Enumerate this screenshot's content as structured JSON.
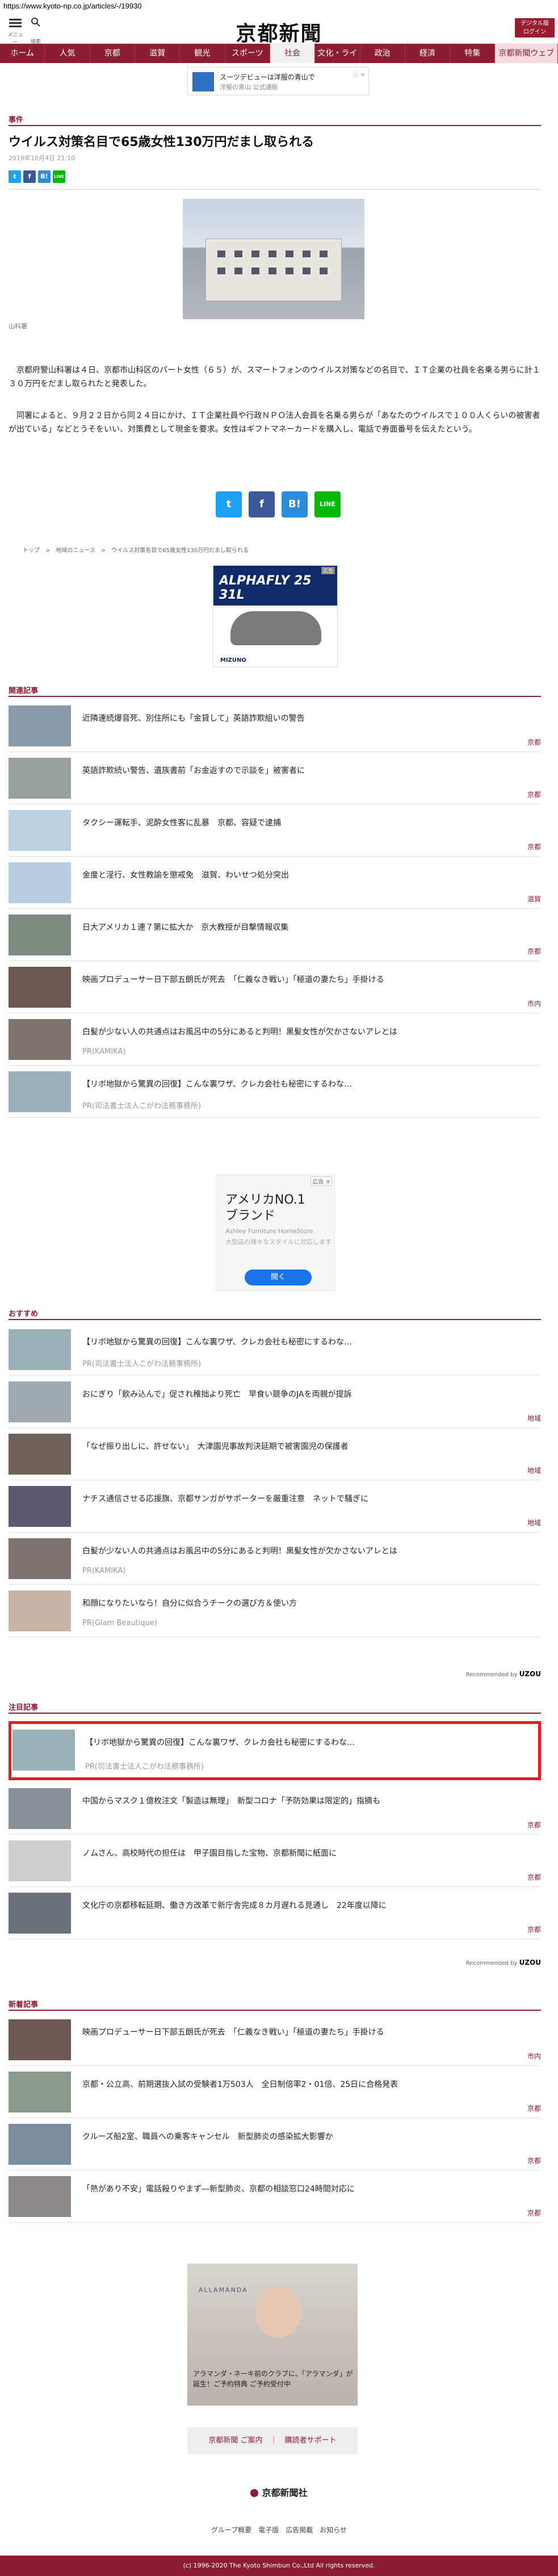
{
  "url": "https://www.kyoto-np.co.jp/articles/-/19930",
  "header": {
    "menu_label": "メニュー",
    "search_label": "検索",
    "logo": "京都新聞",
    "digital_label_1": "デジタル版",
    "digital_label_2": "ログイン"
  },
  "nav": [
    "ホーム",
    "人気",
    "京都",
    "滋賀",
    "観光",
    "スポーツ",
    "社会",
    "文化・ライフ",
    "政治",
    "経済",
    "特集",
    "京都新聞ウェブ"
  ],
  "top_ad": {
    "line1": "スーツデビューは洋服の青山で",
    "line2": "洋服の青山 公式通販",
    "close": "ⓘ ✕"
  },
  "article": {
    "section": "事件",
    "headline": "ウイルス対策名目で65歳女性130万円だまし取られる",
    "date": "2019年10月4日 21:10",
    "caption": "山科署",
    "p1": "京都府警山科署は４日、京都市山科区のパート女性（６５）が、スマートフォンのウイルス対策などの名目で、ＩＴ企業の社員を名乗る男らに計１３０万円をだまし取られたと発表した。",
    "p2": "同署によると、９月２２日から同２４日にかけ、ＩＴ企業社員や行政ＮＰＯ法人会員を名乗る男らが「あなたのウイルスで１００人くらいの被害者が出ている」などとうそをいい、対策費として現金を要求。女性はギフトマネーカードを購入し、電話で券面番号を伝えたという。"
  },
  "share": {
    "t": "t",
    "f": "f",
    "b": "B!",
    "line": "LINE"
  },
  "breadcrumb": "トップ　>　地域のニュース　>　ウイルス対策名目で65歳女性130万円だまし取られる",
  "mid_ad": {
    "brand": "ALPHAFLY 25 31L",
    "maker": "MIZUNO",
    "tag": "広告"
  },
  "related": {
    "title": "関連記事",
    "items": [
      {
        "title": "近隣連続爆音死、別住所にも「金貸して」英語詐欺組いの警告",
        "src": "京都"
      },
      {
        "title": "英語詐欺続い警告、遺族書前「お金返すので示談を」被害者に",
        "src": "京都"
      },
      {
        "title": "タクシー運転手、泥酔女性客に乱暴　京都、容疑で逮捕",
        "src": "京都"
      },
      {
        "title": "金度と淫行、女性教諭を懲戒免　滋賀、わいせつ処分突出",
        "src": "滋賀"
      },
      {
        "title": "日大アメリカ１連７第に拡大か　京大教授が目撃情報収集",
        "src": "京都"
      },
      {
        "title": "映画プロデューサー日下部五朗氏が死去　「仁義なき戦い」「極道の妻たち」手掛ける",
        "src": "市内"
      },
      {
        "title": "白髪が少ない人の共通点はお風呂中の5分にあると判明！黒髪女性が欠かさないアレとは",
        "pr": "PR(KAMIKA)"
      },
      {
        "title": "【リボ地獄から驚異の回復】こんな裏ワザ、クレカ会社も秘密にするわな…",
        "pr": "PR(司法書士法人こがわ法務事務所)"
      }
    ]
  },
  "ad2": {
    "tag": "広告 ✕",
    "line1": "アメリカNO.1",
    "line2": "ブランド",
    "advertiser": "Ashley Furniture HomeStore",
    "desc": "大型店の様々なスタイルに対応します",
    "button": "開く"
  },
  "recommend": {
    "title": "おすすめ",
    "items": [
      {
        "title": "【リボ地獄から驚異の回復】こんな裏ワザ、クレカ会社も秘密にするわな…",
        "pr": "PR(司法書士法人こがわ法務事務所)"
      },
      {
        "title": "おにぎり「飲み込んで」促され稚拙より死亡　早食い競争のJAを両親が提訴",
        "src": "地域"
      },
      {
        "title": "「なぜ振り出しに、許せない」　大津園児事故判決延期で被害園児の保護者",
        "src": "地域"
      },
      {
        "title": "ナチス通信させる応援旗、京都サンガがサポーターを厳重注意　ネットで騒ぎに",
        "src": "地域"
      },
      {
        "title": "白髪が少ない人の共通点はお風呂中の5分にあると判明！黒髪女性が欠かさないアレとは",
        "pr": "PR(KAMIKA)"
      },
      {
        "title": "和顔になりたいなら！自分に似合うチークの選び方＆使い方",
        "pr": "PR(Glam Beautique)"
      }
    ],
    "by": "Recommended by",
    "by_brand": "UZOU"
  },
  "attention": {
    "title": "注目記事",
    "items": [
      {
        "title": "【リボ地獄から驚異の回復】こんな裏ワザ、クレカ会社も秘密にするわな…",
        "pr": "PR(司法書士法人こがわ法務事務所)"
      },
      {
        "title": "中国からマスク１億枚注文「製造は無理」　新型コロナ「予防効果は限定的」指摘も",
        "src": "京都"
      },
      {
        "title": "ノムさん、高校時代の担任は　甲子園目指した宝物、京都新聞に紙面に",
        "src": "京都"
      },
      {
        "title": "文化庁の京都移転延期、働き方改革で新庁舎完成８カ月遅れる見通し　22年度以降に",
        "src": "京都"
      }
    ],
    "by": "Recommended by",
    "by_brand": "UZOU"
  },
  "latest": {
    "title": "新着記事",
    "items": [
      {
        "title": "映画プロデューサー日下部五朗氏が死去　「仁義なき戦い」「極道の妻たち」手掛ける",
        "src": "市内"
      },
      {
        "title": "京都・公立高、前期選抜入試の受験者1万503人　全日制倍率2・01倍、25日に合格発表",
        "src": "京都"
      },
      {
        "title": "クルーズ船2室、職員への乗客キャンセル　新型肺炎の感染拡大影響か",
        "src": "京都"
      },
      {
        "title": "「熱があり不安」電話殺りやまず―新型肺炎、京都の相談窓口24時間対応に",
        "src": "京都"
      }
    ]
  },
  "footer_ad": {
    "brand": "ALLAMANDA",
    "text": "アラマンダ・ネーキ前のクラブに、「アラマンダ」が誕生！ご予約特典 ご予約受付中"
  },
  "footer": {
    "links": "京都新聞 ご案内　｜　購読者サポート",
    "logo": "京都新聞社",
    "menu": "グループ概要　電子版　広告掲載　お知らせ",
    "copyright": "(c) 1996-2020 The Kyoto Shimbun Co.,Ltd All rights reserved."
  },
  "colors": {
    "brand": "#8c1d33",
    "highlight": "#e02020"
  }
}
